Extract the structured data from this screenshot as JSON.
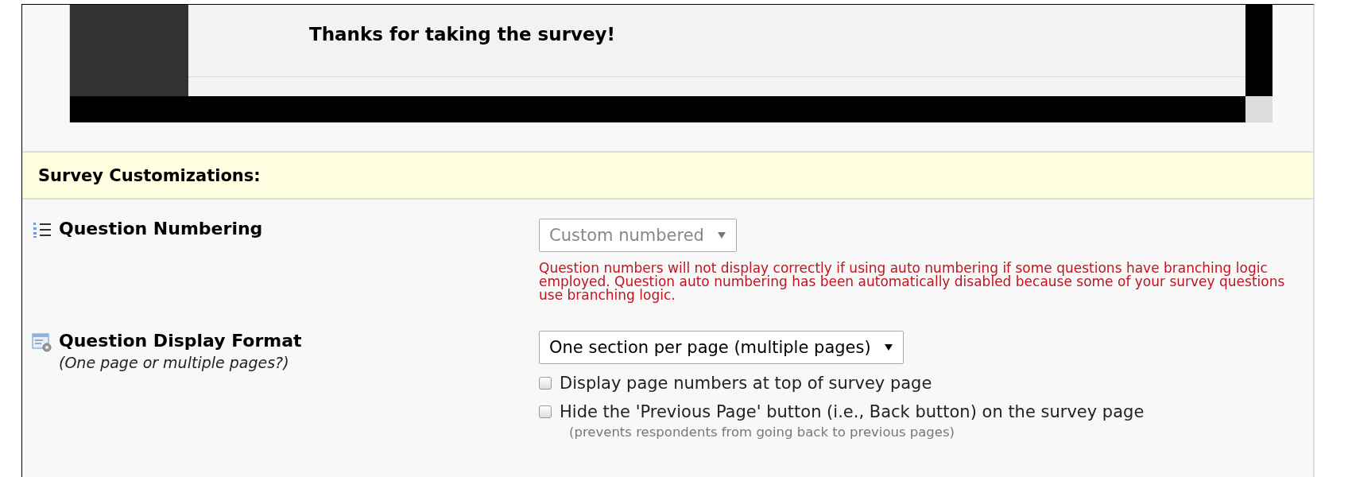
{
  "preview": {
    "message": "Thanks for taking the survey!"
  },
  "section": {
    "title": "Survey Customizations:"
  },
  "settings": [
    {
      "kind": "numbering",
      "label": "Question Numbering",
      "select": {
        "value": "Custom numbered",
        "disabled": true
      },
      "warning": "Question numbers will not display correctly if using auto numbering if some questions have branching logic employed. Question auto numbering has been automatically disabled because some of your survey questions use branching logic."
    },
    {
      "kind": "display",
      "label": "Question Display Format",
      "hint": "(One page or multiple pages?)",
      "select": {
        "value": "One section per page (multiple pages)",
        "disabled": false
      },
      "options": [
        {
          "label": "Display page numbers at top of survey page",
          "checked": false
        },
        {
          "label": "Hide the 'Previous Page' button (i.e., Back button) on the survey page",
          "checked": false,
          "note": "(prevents respondents from going back to previous pages)"
        }
      ]
    }
  ]
}
